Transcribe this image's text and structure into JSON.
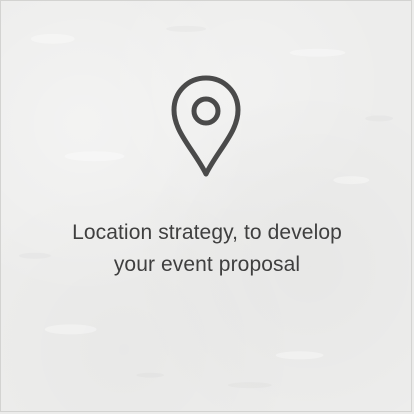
{
  "card": {
    "icon": "map-pin-icon",
    "caption_line_1": "Location strategy, to develop",
    "caption_line_2": "your event proposal"
  },
  "colors": {
    "background": "#ededec",
    "border": "#d3d3d1",
    "icon": "#4a4a4a",
    "text": "#3f3f3f"
  }
}
